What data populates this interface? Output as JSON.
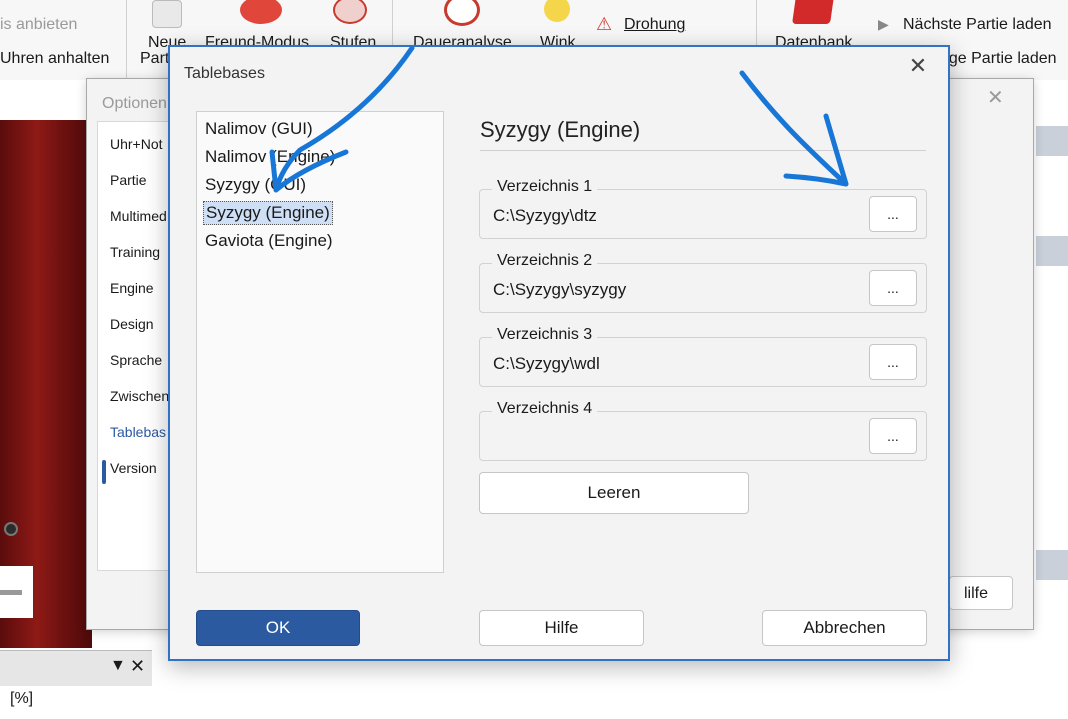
{
  "ribbon": {
    "partial_top_left": "is anbieten",
    "partial_uhren": "Uhren anhalten",
    "neue": "Neue",
    "neue_partial": "Parti",
    "freund_modus": "Freund-Modus",
    "stufen": "Stufen",
    "dauer": "Daueranalyse",
    "wink": "Wink",
    "drohung": "Drohung",
    "datenbank": "Datenbank",
    "naechste": "Nächste Partie laden",
    "vorige_partial": "rige Partie laden"
  },
  "options_dialog": {
    "title": "Optionen",
    "nav_items": [
      "Uhr+Not",
      "Partie",
      "Multimed",
      "Training",
      "Engine",
      "Design",
      "Sprache",
      "Zwischen",
      "Tablebas",
      "Version"
    ],
    "active_item": "Tablebas",
    "hilfe_partial": "lilfe"
  },
  "tablebases": {
    "title": "Tablebases",
    "close_glyph": "✕",
    "list": [
      "Nalimov (GUI)",
      "Nalimov (Engine)",
      "Syzygy (GUI)",
      "Syzygy (Engine)",
      "Gaviota (Engine)"
    ],
    "selected": "Syzygy (Engine)",
    "heading": "Syzygy (Engine)",
    "dirs": [
      {
        "label": "Verzeichnis 1",
        "path": "C:\\Syzygy\\dtz"
      },
      {
        "label": "Verzeichnis 2",
        "path": "C:\\Syzygy\\syzygy"
      },
      {
        "label": "Verzeichnis 3",
        "path": "C:\\Syzygy\\wdl"
      },
      {
        "label": "Verzeichnis 4",
        "path": ""
      }
    ],
    "browse_label": "...",
    "clear_label": "Leeren",
    "ok_label": "OK",
    "help_label": "Hilfe",
    "cancel_label": "Abbrechen"
  },
  "bottom_panel": {
    "percent_label": "[%]",
    "dropdown_glyph": "▼",
    "close_glyph": "✕"
  },
  "colors": {
    "accent": "#2c5aa0",
    "window_border": "#2f72c6",
    "annotation": "#1877d6",
    "board_wood": "#8e1a16"
  }
}
